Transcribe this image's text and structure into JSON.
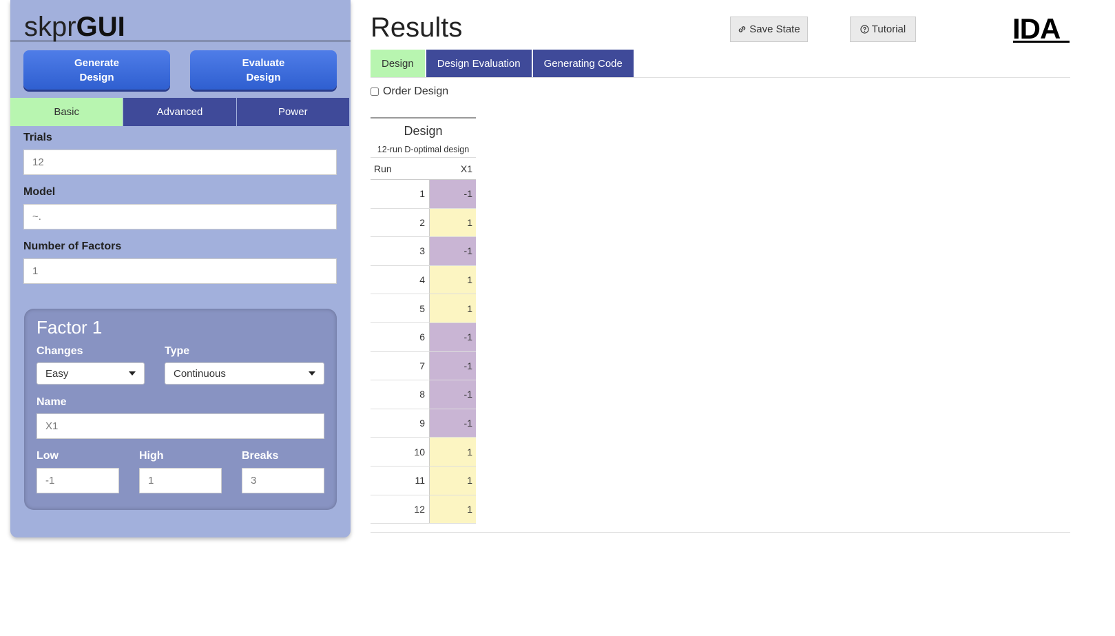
{
  "app": {
    "brand_light": "skpr",
    "brand_bold": "GUI"
  },
  "sidebar": {
    "generate_label": "Generate\nDesign",
    "evaluate_label": "Evaluate\nDesign",
    "tabs": [
      {
        "label": "Basic",
        "active": true
      },
      {
        "label": "Advanced",
        "active": false
      },
      {
        "label": "Power",
        "active": false
      }
    ],
    "trials": {
      "label": "Trials",
      "value": "12"
    },
    "model": {
      "label": "Model",
      "value": "~."
    },
    "num_factors": {
      "label": "Number of Factors",
      "value": "1"
    },
    "factor": {
      "title": "Factor 1",
      "changes": {
        "label": "Changes",
        "value": "Easy"
      },
      "type": {
        "label": "Type",
        "value": "Continuous"
      },
      "name": {
        "label": "Name",
        "value": "X1"
      },
      "low": {
        "label": "Low",
        "value": "-1"
      },
      "high": {
        "label": "High",
        "value": "1"
      },
      "breaks": {
        "label": "Breaks",
        "value": "3"
      }
    }
  },
  "main": {
    "title": "Results",
    "save_state_label": "Save State",
    "tutorial_label": "Tutorial",
    "logo_text": "IDA",
    "tabs": [
      {
        "label": "Design",
        "active": true
      },
      {
        "label": "Design Evaluation",
        "active": false
      },
      {
        "label": "Generating Code",
        "active": false
      }
    ],
    "order_design_label": "Order Design",
    "order_design_checked": false,
    "design_table": {
      "title": "Design",
      "subtitle": "12-run D-optimal design",
      "col_run": "Run",
      "col_x1": "X1",
      "rows": [
        {
          "run": "1",
          "x1": "-1"
        },
        {
          "run": "2",
          "x1": "1"
        },
        {
          "run": "3",
          "x1": "-1"
        },
        {
          "run": "4",
          "x1": "1"
        },
        {
          "run": "5",
          "x1": "1"
        },
        {
          "run": "6",
          "x1": "-1"
        },
        {
          "run": "7",
          "x1": "-1"
        },
        {
          "run": "8",
          "x1": "-1"
        },
        {
          "run": "9",
          "x1": "-1"
        },
        {
          "run": "10",
          "x1": "1"
        },
        {
          "run": "11",
          "x1": "1"
        },
        {
          "run": "12",
          "x1": "1"
        }
      ],
      "colors": {
        "neg": "#c9b5d4",
        "pos": "#fcf5c2"
      }
    }
  },
  "colors": {
    "sidebar_bg": "#a2b0dc",
    "tab_dark": "#3f4a99",
    "tab_active": "#b8f5b0",
    "button_blue": "#3b6be0"
  },
  "icons": {
    "save_state": "link-icon",
    "tutorial": "question-circle-icon",
    "dropdown": "caret-down-icon"
  }
}
